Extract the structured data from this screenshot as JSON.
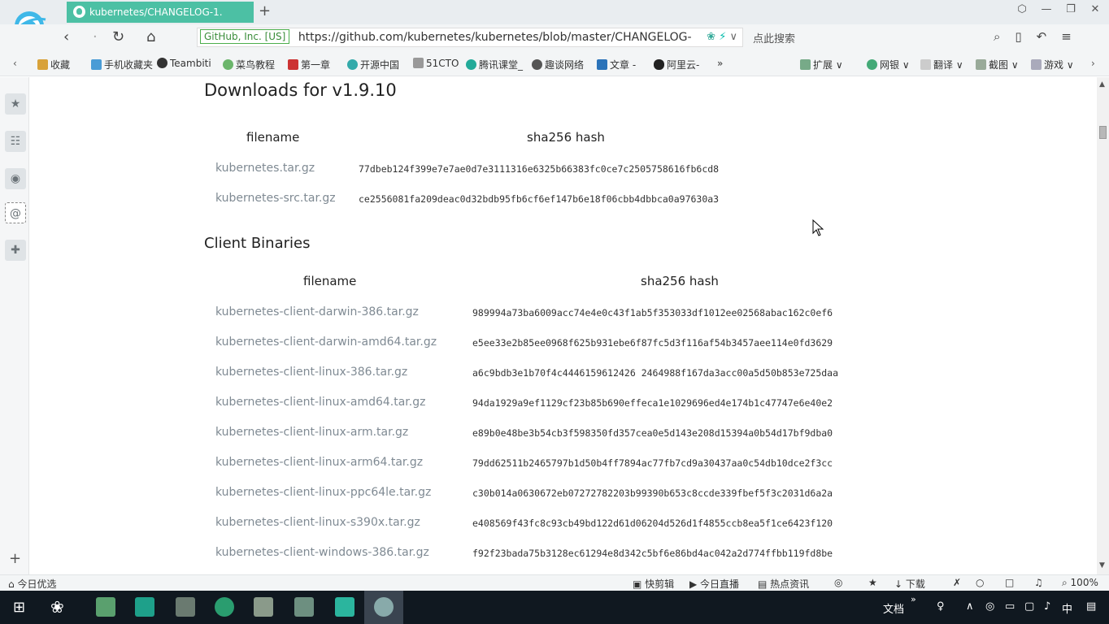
{
  "browser": {
    "tab_title": "kubernetes/CHANGELOG-1.",
    "new_tab": "+",
    "window_controls": [
      "⬡",
      "—",
      "❐",
      "✕"
    ],
    "security_label": "GitHub, Inc. [US]",
    "url": "https://github.com/kubernetes/kubernetes/blob/master/CHANGELOG-",
    "search_placeholder": "点此搜索",
    "bookmarks": [
      "收藏",
      "手机收藏夹",
      "Teambiti",
      "菜鸟教程",
      "第一章",
      "开源中国",
      "51CTO",
      "腾讯课堂_",
      "趣谈网络",
      "文章 -",
      "阿里云-",
      "»"
    ],
    "extensions": [
      "扩展",
      "网银",
      "翻译",
      "截图",
      "游戏"
    ]
  },
  "page": {
    "downloads_heading": "Downloads for v1.9.10",
    "client_heading": "Client Binaries",
    "col_filename": "filename",
    "col_hash": "sha256 hash",
    "downloads": [
      {
        "file": "kubernetes.tar.gz",
        "hash": "77dbeb124f399e7e7ae0d7e3111316e6325b66383fc0ce7c2505758616fb6cd8"
      },
      {
        "file": "kubernetes-src.tar.gz",
        "hash": "ce2556081fa209deac0d32bdb95fb6cf6ef147b6e18f06cbb4dbbca0a97630a3"
      }
    ],
    "client": [
      {
        "file": "kubernetes-client-darwin-386.tar.gz",
        "hash": "989994a73ba6009acc74e4e0c43f1ab5f353033df1012ee02568abac162c0ef6"
      },
      {
        "file": "kubernetes-client-darwin-amd64.tar.gz",
        "hash": "e5ee33e2b85ee0968f625b931ebe6f87fc5d3f116af54b3457aee114e0fd3629"
      },
      {
        "file": "kubernetes-client-linux-386.tar.gz",
        "hash": "a6c9bdb3e1b70f4c4446159612426 2464988f167da3acc00a5d50b853e725daa"
      },
      {
        "file": "kubernetes-client-linux-amd64.tar.gz",
        "hash": "94da1929a9ef1129cf23b85b690effeca1e1029696ed4e174b1c47747e6e40e2"
      },
      {
        "file": "kubernetes-client-linux-arm.tar.gz",
        "hash": "e89b0e48be3b54cb3f598350fd357cea0e5d143e208d15394a0b54d17bf9dba0"
      },
      {
        "file": "kubernetes-client-linux-arm64.tar.gz",
        "hash": "79dd62511b2465797b1d50b4ff7894ac77fb7cd9a30437aa0c54db10dce2f3cc"
      },
      {
        "file": "kubernetes-client-linux-ppc64le.tar.gz",
        "hash": "c30b014a0630672eb07272782203b99390b653c8ccde339fbef5f3c2031d6a2a"
      },
      {
        "file": "kubernetes-client-linux-s390x.tar.gz",
        "hash": "e408569f43fc8c93cb49bd122d61d06204d526d1f4855ccb8ea5f1ce6423f120"
      },
      {
        "file": "kubernetes-client-windows-386.tar.gz",
        "hash": "f92f23bada75b3128ec61294e8d342c5bf6e86bd4ac042a2d774ffbb119fd8be"
      }
    ]
  },
  "statusbar": {
    "today": "今日优选",
    "quick_cut": "快剪辑",
    "live": "今日直播",
    "news": "热点资讯",
    "download": "下载",
    "zoom": "100%"
  },
  "taskbar": {
    "doc_label": "文档",
    "ime": "中",
    "chevron": "»"
  },
  "colors": {
    "accent": "#4cc0a4",
    "link_gray": "#7f8a93",
    "taskbar": "#101820"
  }
}
